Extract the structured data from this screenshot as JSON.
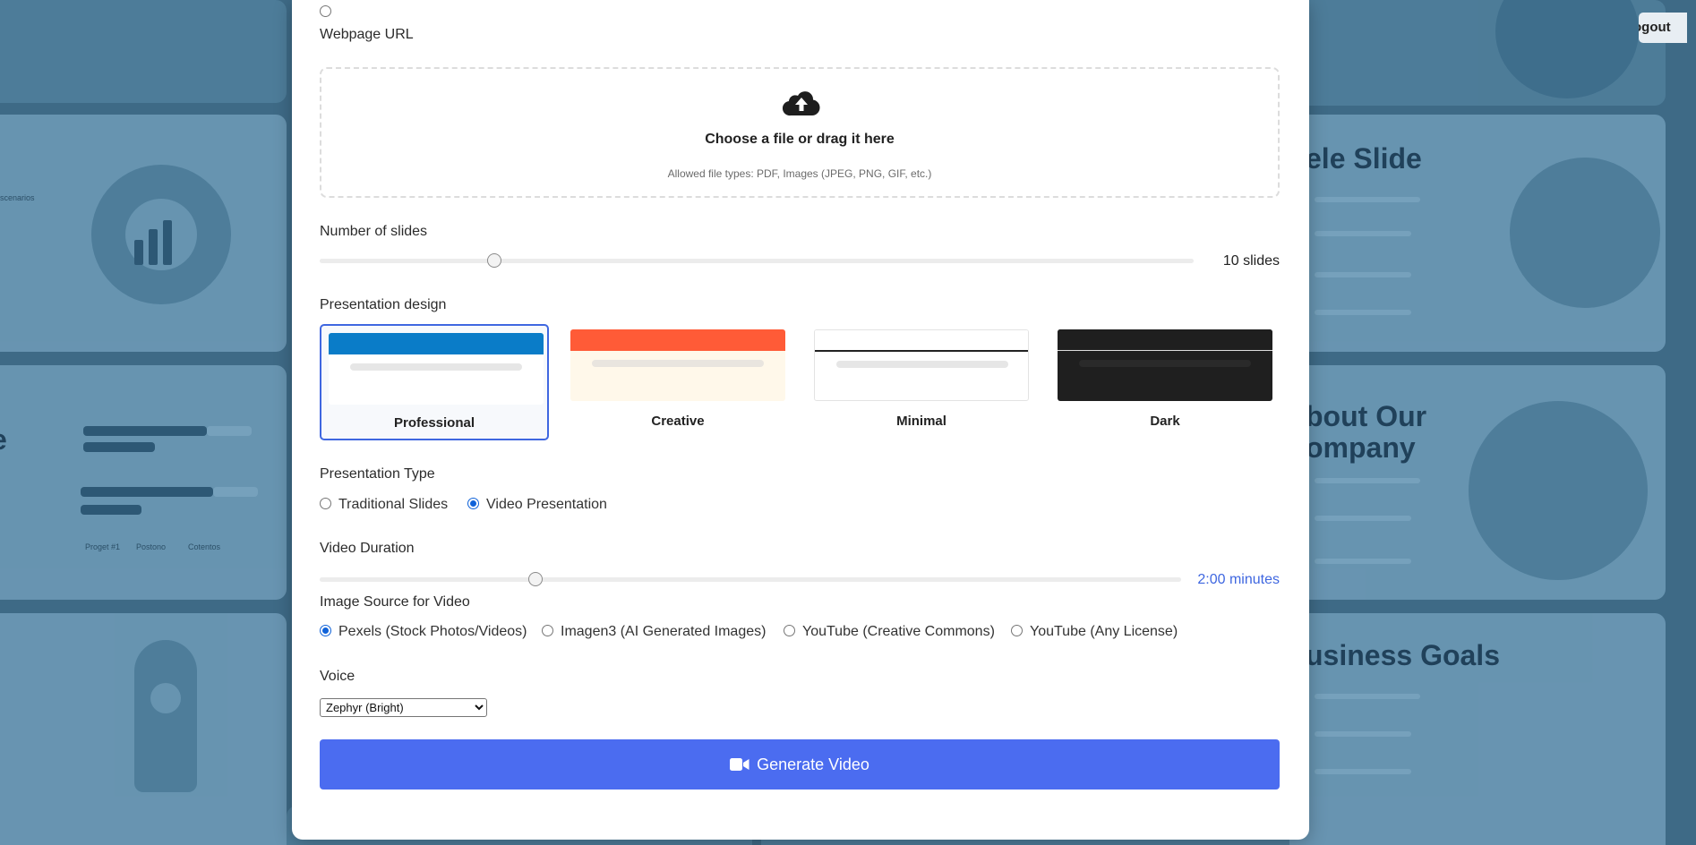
{
  "background": {
    "title_slide": "ele Slide",
    "about_slide": "bout Our\nompany",
    "goals_slide": "usiness Goals",
    "left_slide_letter": "e",
    "table_headers": [
      "Proget #1",
      "Postono",
      "Cotentos"
    ]
  },
  "header": {
    "logout_label": "ogout"
  },
  "form": {
    "webpage_url_label": "Webpage URL",
    "upload": {
      "title": "Choose a file or drag it here",
      "hint": "Allowed file types: PDF, Images (JPEG, PNG, GIF, etc.)"
    },
    "slides": {
      "label": "Number of slides",
      "value_text": "10 slides",
      "fraction": 0.2
    },
    "design": {
      "label": "Presentation design",
      "options": [
        {
          "name": "Professional",
          "selected": true,
          "bar_color": "#0a7cc8",
          "bg": "#ffffff",
          "line_color": "#e6e6e6"
        },
        {
          "name": "Creative",
          "selected": false,
          "bar_color": "#ff5b37",
          "bg": "#fff8ea",
          "line_color": "#e9e5df"
        },
        {
          "name": "Minimal",
          "selected": false,
          "bar_color": "#ffffff",
          "bg": "#ffffff",
          "line_color": "#e6e6e6"
        },
        {
          "name": "Dark",
          "selected": false,
          "bar_color": "#1f1f1f",
          "bg": "#1f1f1f",
          "line_color": "#2a2a2a"
        }
      ]
    },
    "type": {
      "label": "Presentation Type",
      "options": [
        {
          "label": "Traditional Slides",
          "checked": false
        },
        {
          "label": "Video Presentation",
          "checked": true
        }
      ]
    },
    "duration": {
      "label": "Video Duration",
      "value_text": "2:00 minutes",
      "fraction": 0.25,
      "accent": "#3f67e0"
    },
    "image_source": {
      "label": "Image Source for Video",
      "options": [
        {
          "label": "Pexels (Stock Photos/Videos)",
          "checked": true
        },
        {
          "label": "Imagen3 (AI Generated Images)",
          "checked": false
        },
        {
          "label": "YouTube (Creative Commons)",
          "checked": false
        },
        {
          "label": "YouTube (Any License)",
          "checked": false
        }
      ]
    },
    "voice": {
      "label": "Voice",
      "selected": "Zephyr (Bright)"
    },
    "submit_label": "Generate Video",
    "submit_icon": "video-camera-icon"
  }
}
